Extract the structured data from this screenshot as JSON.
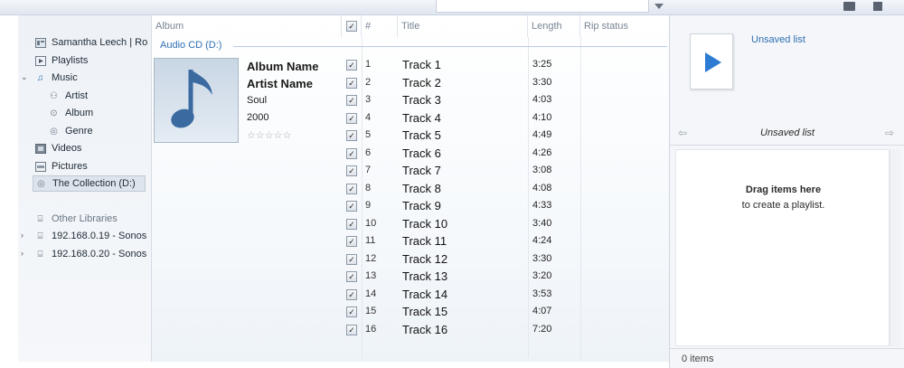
{
  "nav": {
    "user_library": "Samantha Leech | Ro",
    "playlists": "Playlists",
    "music": "Music",
    "artist": "Artist",
    "album": "Album",
    "genre": "Genre",
    "videos": "Videos",
    "pictures": "Pictures",
    "collection": "The Collection (D:)",
    "other_libraries": "Other Libraries",
    "sonos1": "192.168.0.19 - Sonos",
    "sonos2": "192.168.0.20 - Sonos"
  },
  "columns": {
    "album": "Album",
    "number": "#",
    "title": "Title",
    "length": "Length",
    "rip_status": "Rip status"
  },
  "group": "Audio CD (D:)",
  "album_info": {
    "album_name": "Album Name",
    "artist_name": "Artist Name",
    "genre": "Soul",
    "year": "2000",
    "rating": "☆☆☆☆☆"
  },
  "tracks": [
    {
      "num": "1",
      "title": "Track 1",
      "length": "3:25"
    },
    {
      "num": "2",
      "title": "Track 2",
      "length": "3:30"
    },
    {
      "num": "3",
      "title": "Track 3",
      "length": "4:03"
    },
    {
      "num": "4",
      "title": "Track 4",
      "length": "4:10"
    },
    {
      "num": "5",
      "title": "Track 5",
      "length": "4:49"
    },
    {
      "num": "6",
      "title": "Track 6",
      "length": "4:26"
    },
    {
      "num": "7",
      "title": "Track 7",
      "length": "3:08"
    },
    {
      "num": "8",
      "title": "Track 8",
      "length": "4:08"
    },
    {
      "num": "9",
      "title": "Track 9",
      "length": "4:33"
    },
    {
      "num": "10",
      "title": "Track 10",
      "length": "3:40"
    },
    {
      "num": "11",
      "title": "Track 11",
      "length": "4:24"
    },
    {
      "num": "12",
      "title": "Track 12",
      "length": "3:30"
    },
    {
      "num": "13",
      "title": "Track 13",
      "length": "3:20"
    },
    {
      "num": "14",
      "title": "Track 14",
      "length": "3:53"
    },
    {
      "num": "15",
      "title": "Track 15",
      "length": "4:07"
    },
    {
      "num": "16",
      "title": "Track 16",
      "length": "7:20"
    }
  ],
  "list_pane": {
    "unsaved_link": "Unsaved list",
    "list_title": "Unsaved list",
    "drag_line1": "Drag items here",
    "drag_line2": "to create a playlist.",
    "item_count": "0 items"
  },
  "colors": {
    "accent_blue": "#2f6fb3",
    "play_blue": "#2e7bd3"
  }
}
